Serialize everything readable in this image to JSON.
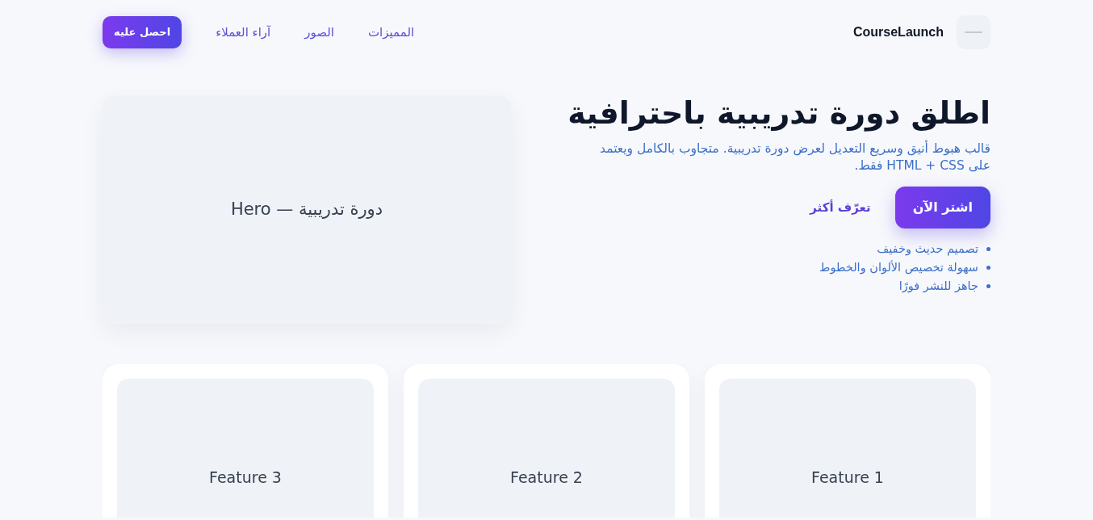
{
  "brand": {
    "name": "CourseLaunch"
  },
  "nav": {
    "links": [
      {
        "label": "المميزات"
      },
      {
        "label": "الصور"
      },
      {
        "label": "آراء العملاء"
      }
    ],
    "cta": "احصل عليه"
  },
  "hero": {
    "title": "اطلق دورة تدريبية باحترافية",
    "lead": "قالب هبوط أنيق وسريع التعديل لعرض دورة تدريبية. متجاوب بالكامل ويعتمد على HTML + CSS فقط.",
    "buttons": [
      {
        "label": "اشتر الآن",
        "kind": "primary"
      },
      {
        "label": "تعرّف أكثر",
        "kind": "link"
      }
    ],
    "bullets": [
      "تصميم حديث وخفيف",
      "سهولة تخصيص الألوان والخطوط",
      "جاهز للنشر فورًا"
    ],
    "media_label": "دورة تدريبية — Hero"
  },
  "features": [
    {
      "label": "Feature 1"
    },
    {
      "label": "Feature 2"
    },
    {
      "label": "Feature 3"
    }
  ]
}
